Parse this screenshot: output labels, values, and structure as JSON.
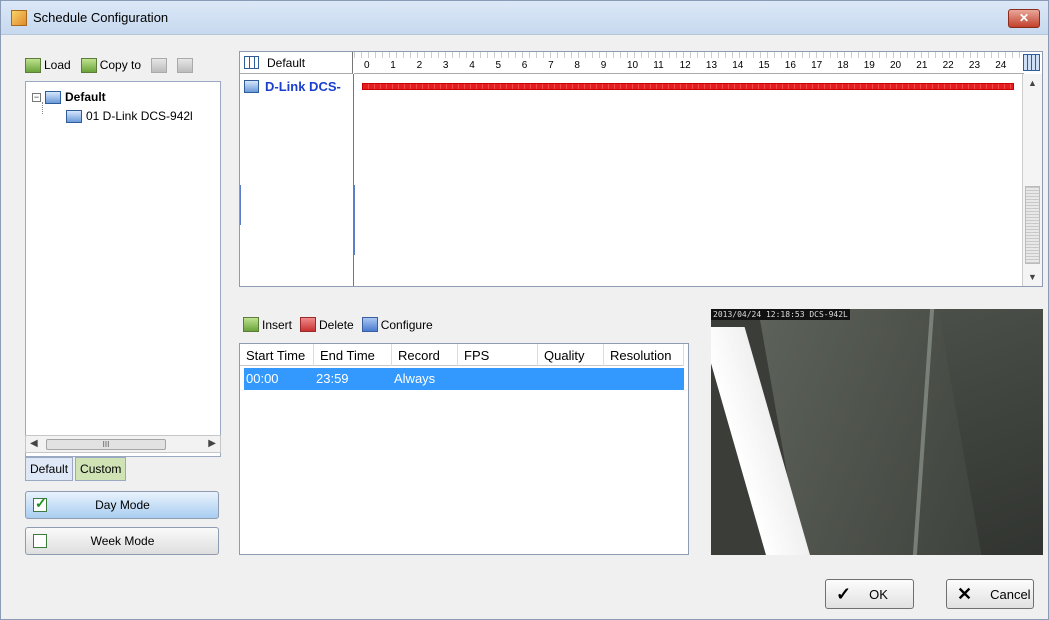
{
  "window": {
    "title": "Schedule Configuration",
    "close_label": "✕"
  },
  "left_toolbar": {
    "load_label": "Load",
    "copyto_label": "Copy to"
  },
  "tree": {
    "root_label": "Default",
    "child_label": "01 D-Link DCS-942l"
  },
  "tree_scroll": {
    "thumb_text": "III"
  },
  "tabs": [
    {
      "label": "Default"
    },
    {
      "label": "Custom"
    }
  ],
  "modes": {
    "day_label": "Day Mode",
    "week_label": "Week Mode",
    "day_selected": true
  },
  "schedule_grid": {
    "header_label": "Default",
    "hours": [
      "0",
      "1",
      "2",
      "3",
      "4",
      "5",
      "6",
      "7",
      "8",
      "9",
      "10",
      "11",
      "12",
      "13",
      "14",
      "15",
      "16",
      "17",
      "18",
      "19",
      "20",
      "21",
      "22",
      "23",
      "24"
    ],
    "row_label": "D-Link DCS-",
    "bar_color": "#e31e1e"
  },
  "list_toolbar": {
    "insert_label": "Insert",
    "delete_label": "Delete",
    "configure_label": "Configure"
  },
  "schedule_list": {
    "columns": [
      "Start Time",
      "End Time",
      "Record",
      "FPS",
      "Quality",
      "Resolution"
    ],
    "rows": [
      {
        "start": "00:00",
        "end": "23:59",
        "record": "Always",
        "fps": "",
        "quality": "",
        "resolution": ""
      }
    ]
  },
  "preview": {
    "timestamp": "2013/04/24 12:18:53 DCS-942L"
  },
  "footer": {
    "ok_label": "OK",
    "cancel_label": "Cancel"
  }
}
